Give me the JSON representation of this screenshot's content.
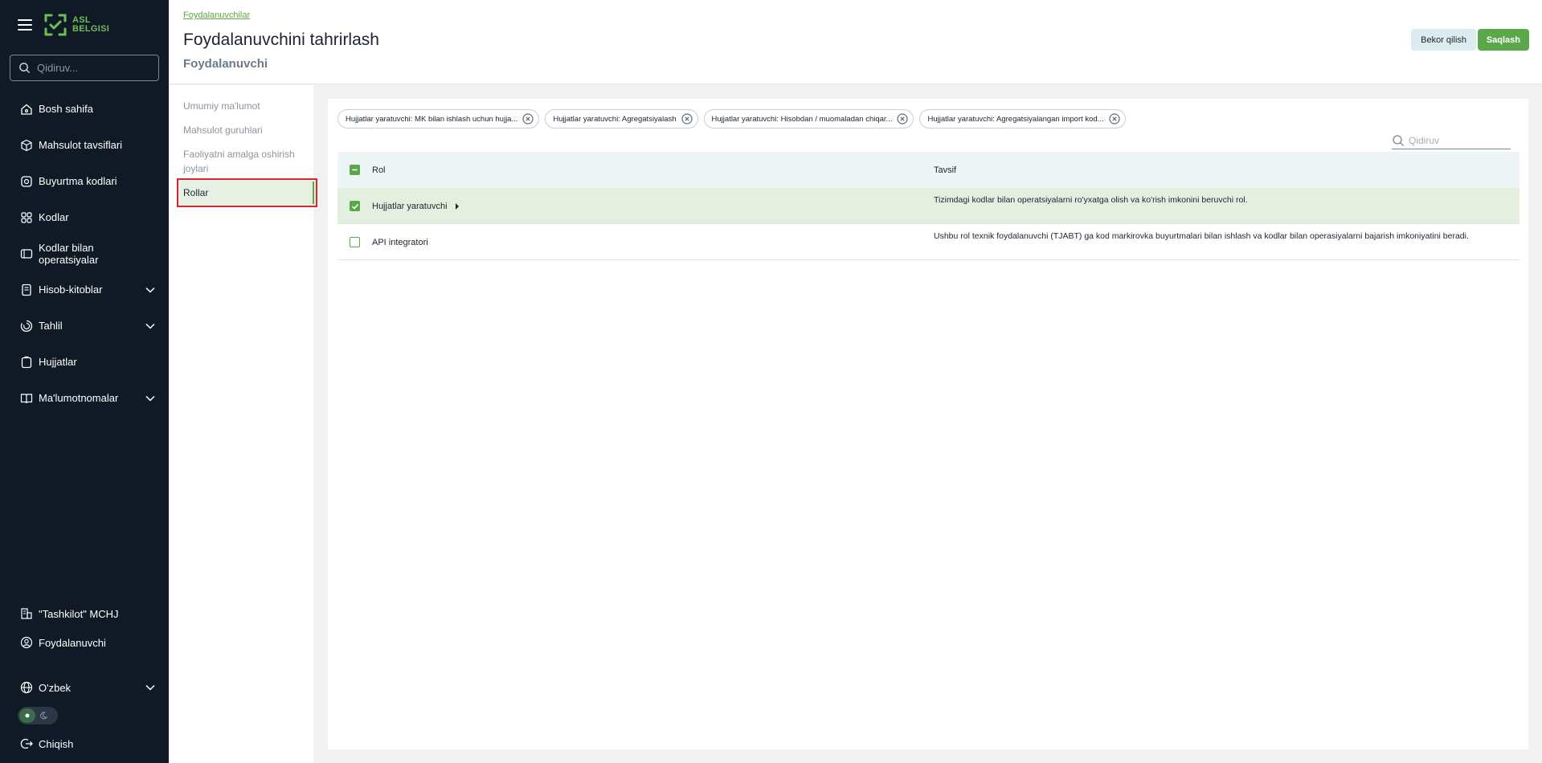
{
  "sidebar": {
    "logo_line1": "ASL",
    "logo_line2": "BELGISI",
    "search_placeholder": "Qidiruv...",
    "items": [
      {
        "label": "Bosh sahifa",
        "icon": "home-icon"
      },
      {
        "label": "Mahsulot tavsiflari",
        "icon": "box-icon"
      },
      {
        "label": "Buyurtma kodlari",
        "icon": "order-codes-icon"
      },
      {
        "label": "Kodlar",
        "icon": "codes-icon"
      },
      {
        "label": "Kodlar bilan operatsiyalar",
        "icon": "operations-icon"
      },
      {
        "label": "Hisob-kitoblar",
        "icon": "reports-icon"
      },
      {
        "label": "Tahlil",
        "icon": "analytics-icon"
      },
      {
        "label": "Hujjatlar",
        "icon": "documents-icon"
      },
      {
        "label": "Ma'lumotnomalar",
        "icon": "reference-icon"
      }
    ],
    "bottom": {
      "org": "\"Tashkilot\" MCHJ",
      "user": "Foydalanuvchi",
      "language": "O'zbek",
      "logout": "Chiqish"
    }
  },
  "header": {
    "breadcrumb": "Foydalanuvchilar",
    "title": "Foydalanuvchini tahrirlash",
    "subtitle": "Foydalanuvchi",
    "cancel_label": "Bekor qilish",
    "save_label": "Saqlash"
  },
  "subnav": {
    "items": [
      {
        "label": "Umumiy ma'lumot"
      },
      {
        "label": "Mahsulot guruhlari"
      },
      {
        "label": "Faoliyatni amalga oshirish joylari"
      },
      {
        "label": "Rollar"
      }
    ],
    "active": "Rollar"
  },
  "roles": {
    "chips": [
      "Hujjatlar yaratuvchi: MK bilan ishlash uchun hujja...",
      "Hujjatlar yaratuvchi: Agregatsiyalash",
      "Hujjatlar yaratuvchi: Hisobdan / muomaladan chiqar...",
      "Hujjatlar yaratuvchi: Agregatsiyalangan import kod..."
    ],
    "search_placeholder": "Qidiruv",
    "columns": {
      "rol": "Rol",
      "tavsif": "Tavsif"
    },
    "rows": [
      {
        "rol": "Hujjatlar yaratuvchi",
        "tavsif": "Tizimdagi kodlar bilan operatsiyalarni ro'yxatga olish va ko'rish imkonini beruvchi rol.",
        "checked": true
      },
      {
        "rol": "API integratori",
        "tavsif": "Ushbu rol texnik foydalanuvchi (TJABT) ga kod markirovka buyurtmalari bilan ishlash va kodlar bilan operasiyalarni bajarish imkoniyatini beradi.",
        "checked": false
      }
    ]
  },
  "colors": {
    "sidebar_bg": "#0f1a26",
    "accent_green": "#5aa84a",
    "highlight_red": "#d9232e"
  }
}
